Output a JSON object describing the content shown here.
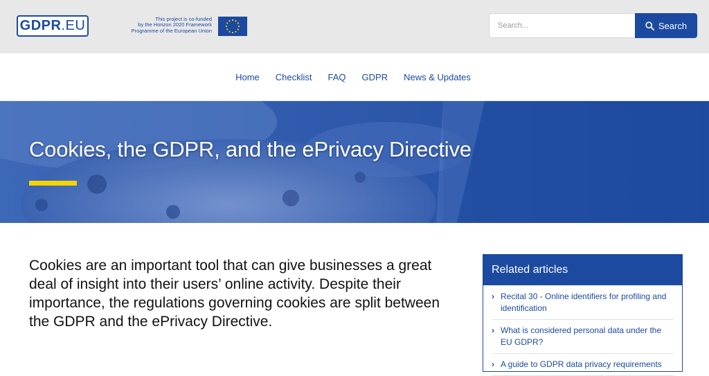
{
  "header": {
    "logo_bold": "GDPR",
    "logo_light": ".EU",
    "cofund_lines": [
      "This project is co-funded",
      "by the Horizon 2020 Framework",
      "Programme of the European Union"
    ],
    "flag_icon": "eu-flag-icon",
    "search": {
      "placeholder": "Search...",
      "button_label": "Search",
      "button_icon": "search-icon"
    },
    "colors": {
      "brand": "#1b4aa0",
      "topbar_bg": "#e8e8e8"
    }
  },
  "nav": {
    "items": [
      {
        "label": "Home"
      },
      {
        "label": "Checklist"
      },
      {
        "label": "FAQ"
      },
      {
        "label": "GDPR"
      },
      {
        "label": "News & Updates"
      }
    ]
  },
  "hero": {
    "title": "Cookies, the GDPR, and the ePrivacy Directive",
    "accent_color": "#f5d400"
  },
  "main": {
    "intro": "Cookies are an important tool that can give businesses a great deal of insight into their users’ online activity. Despite their importance, the regulations governing cookies are split between the GDPR and the ePrivacy Directive."
  },
  "sidebar": {
    "heading": "Related articles",
    "items": [
      {
        "label": "Recital 30 - Online identifiers for profiling and identification"
      },
      {
        "label": "What is considered personal data under the EU GDPR?"
      },
      {
        "label": "A guide to GDPR data privacy requirements"
      }
    ]
  }
}
